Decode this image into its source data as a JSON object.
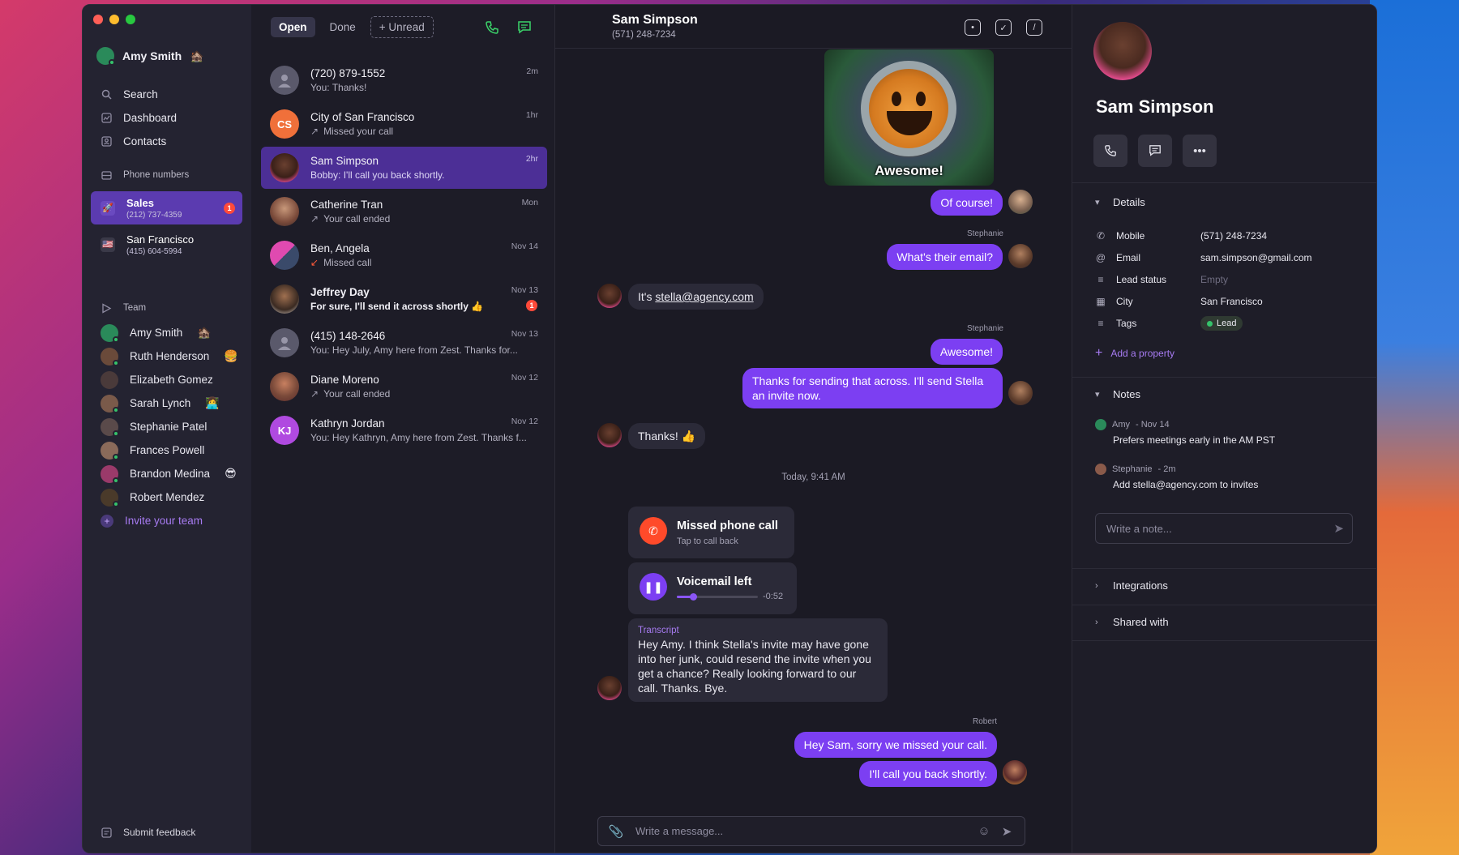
{
  "sidebar": {
    "user": {
      "name": "Amy Smith",
      "emoji": "🏚️"
    },
    "nav": [
      {
        "label": "Search",
        "icon": "search-icon"
      },
      {
        "label": "Dashboard",
        "icon": "dashboard-icon"
      },
      {
        "label": "Contacts",
        "icon": "contacts-icon"
      }
    ],
    "phone_numbers_label": "Phone numbers",
    "phone_numbers": [
      {
        "name": "Sales",
        "number": "(212) 737-4359",
        "icon": "rocket-icon",
        "badge": "1"
      },
      {
        "name": "San Francisco",
        "number": "(415) 604-5994",
        "icon": "us-flag-icon"
      }
    ],
    "team_label": "Team",
    "team": [
      {
        "name": "Amy Smith",
        "emoji": "🏚️",
        "color": "#2a8a5a"
      },
      {
        "name": "Ruth Henderson",
        "emoji": "🍔",
        "color": "#6a4a3a"
      },
      {
        "name": "Elizabeth Gomez",
        "emoji": "",
        "color": "#4a3a3a"
      },
      {
        "name": "Sarah Lynch",
        "emoji": "👩‍💻",
        "color": "#7a5a4a"
      },
      {
        "name": "Stephanie Patel",
        "emoji": "",
        "color": "#5a4a4a"
      },
      {
        "name": "Frances Powell",
        "emoji": "",
        "color": "#8a6a5a"
      },
      {
        "name": "Brandon Medina",
        "emoji": "😎",
        "color": "#9a3a6a"
      },
      {
        "name": "Robert Mendez",
        "emoji": "",
        "color": "#4a3a2a"
      }
    ],
    "invite_label": "Invite your team",
    "feedback_label": "Submit feedback"
  },
  "convlist": {
    "tabs": [
      "Open",
      "Done"
    ],
    "unread_label": "+ Unread",
    "conversations": [
      {
        "name": "(720) 879-1552",
        "sub": "You: Thanks!",
        "time": "2m",
        "initials": "",
        "color": "#5a596b"
      },
      {
        "name": "City of San Francisco",
        "sub": "Missed your call",
        "time": "1hr",
        "initials": "CS",
        "color": "#f0703a",
        "arrow": "↗"
      },
      {
        "name": "Sam Simpson",
        "sub": "Bobby: I'll call you back shortly.",
        "time": "2hr",
        "initials": "",
        "color": "#3a2a2a"
      },
      {
        "name": "Catherine Tran",
        "sub": "Your call ended",
        "time": "Mon",
        "initials": "",
        "color": "#8a6a5a",
        "arrow": "↗"
      },
      {
        "name": "Ben, Angela",
        "sub": "Missed call",
        "time": "Nov 14",
        "initials": "",
        "color": "#c84aa8",
        "arrow": "↙"
      },
      {
        "name": "Jeffrey Day",
        "sub": "For sure, I'll send it across shortly 👍",
        "time": "Nov 13",
        "initials": "",
        "color": "#3a2a22",
        "badge": "1"
      },
      {
        "name": "(415) 148-2646",
        "sub": "You: Hey July, Amy here from Zest. Thanks for...",
        "time": "Nov 13",
        "initials": "",
        "color": "#5a596b"
      },
      {
        "name": "Diane Moreno",
        "sub": "Your call ended",
        "time": "Nov 12",
        "initials": "",
        "color": "#7a4a3a",
        "arrow": "↗"
      },
      {
        "name": "Kathryn Jordan",
        "sub": "You: Hey Kathryn, Amy here from Zest. Thanks f...",
        "time": "Nov 12",
        "initials": "KJ",
        "color": "#b04ae0"
      }
    ]
  },
  "chat": {
    "contact_name": "Sam Simpson",
    "contact_number": "(571) 248-7234",
    "gif_caption": "Awesome!",
    "messages": [
      {
        "text": "Of course!"
      },
      {
        "sender": "Stephanie",
        "text": "What's their email?"
      },
      {
        "text_prefix": "It's ",
        "link": "stella@agency.com"
      },
      {
        "sender": "Stephanie",
        "text": "Awesome!"
      },
      {
        "text": "Thanks for sending that across. I'll send Stella an invite now."
      },
      {
        "text": "Thanks! 👍"
      },
      {
        "sender": "Robert",
        "text": "Hey Sam, sorry we missed your call."
      },
      {
        "text": "I'll call you back shortly."
      }
    ],
    "date_separator": "Today, 9:41 AM",
    "missed_call": {
      "title": "Missed phone call",
      "sub": "Tap to call back"
    },
    "voicemail": {
      "title": "Voicemail left",
      "remaining": "-0:52",
      "progress": 0.2
    },
    "transcript": {
      "label": "Transcript",
      "text": "Hey Amy. I think Stella's invite may have gone into her junk, could resend the invite when you get a chance? Really looking forward to our call. Thanks. Bye."
    },
    "composer_placeholder": "Write a message..."
  },
  "details": {
    "name": "Sam Simpson",
    "details_label": "Details",
    "properties": [
      {
        "label": "Mobile",
        "value": "(571) 248-7234",
        "icon": "phone-icon"
      },
      {
        "label": "Email",
        "value": "sam.simpson@gmail.com",
        "icon": "at-icon"
      },
      {
        "label": "Lead status",
        "value": "Empty",
        "icon": "list-icon",
        "muted": true
      },
      {
        "label": "City",
        "value": "San Francisco",
        "icon": "building-icon"
      },
      {
        "label": "Tags",
        "value": "Lead",
        "icon": "tags-icon"
      }
    ],
    "add_property_label": "Add a property",
    "notes_label": "Notes",
    "notes": [
      {
        "author": "Amy",
        "time": "- Nov 14",
        "text": "Prefers meetings early in the AM PST"
      },
      {
        "author": "Stephanie",
        "time": "- 2m",
        "text": "Add stella@agency.com to invites"
      }
    ],
    "note_placeholder": "Write a note...",
    "integrations_label": "Integrations",
    "shared_with_label": "Shared with"
  }
}
